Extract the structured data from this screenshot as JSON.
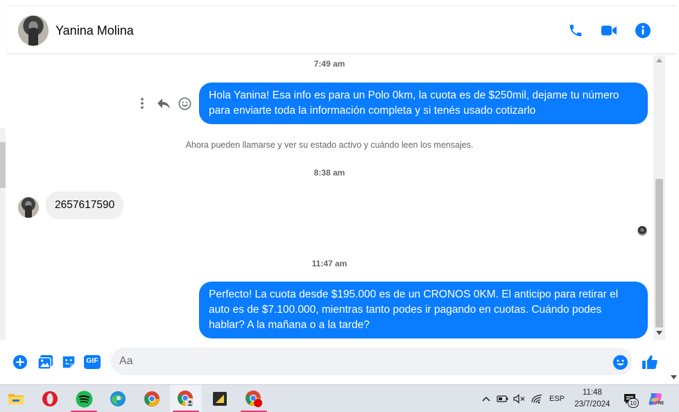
{
  "header": {
    "contact_name": "Yanina Molina",
    "icons": [
      "phone-icon",
      "video-icon",
      "info-icon"
    ]
  },
  "colors": {
    "accent": "#0a7cff",
    "incoming_bubble": "#f0f0f0",
    "taskbar": "#dfe3ea"
  },
  "chat": {
    "ts1": "7:49 am",
    "msg_out_1_line1": "Hola Yanina! Esa info es para un Polo 0km, la cuota es de $250mil, dejame tu número",
    "msg_out_1_line2": "para enviarte toda la información completa y si tenés usado cotizarlo",
    "system_note": "Ahora pueden llamarse y ver su estado activo y cuándo leen los mensajes.",
    "ts2": "8:38 am",
    "msg_in_1": "2657617590",
    "ts3": "11:47 am",
    "msg_out_2_line1": "Perfecto! La cuota desde $195.000 es de un CRONOS 0KM. El anticipo para retirar el",
    "msg_out_2_line2": "auto es de $7.100.000, mientras tanto podes ir pagando en cuotas. Cuándo podes",
    "msg_out_2_line3": "hablar? A la mañana o a la tarde?"
  },
  "composer": {
    "placeholder": "Aa",
    "gif_label": "GIF"
  },
  "taskbar": {
    "apps": [
      "file-explorer",
      "opera",
      "spotify",
      "edge",
      "chrome",
      "chrome-profile",
      "sticky-notes",
      "chrome-notification"
    ],
    "language": "ESP",
    "time": "11:48",
    "date": "23/7/2024",
    "notification_count": "10",
    "copilot_badge": "PRE"
  }
}
